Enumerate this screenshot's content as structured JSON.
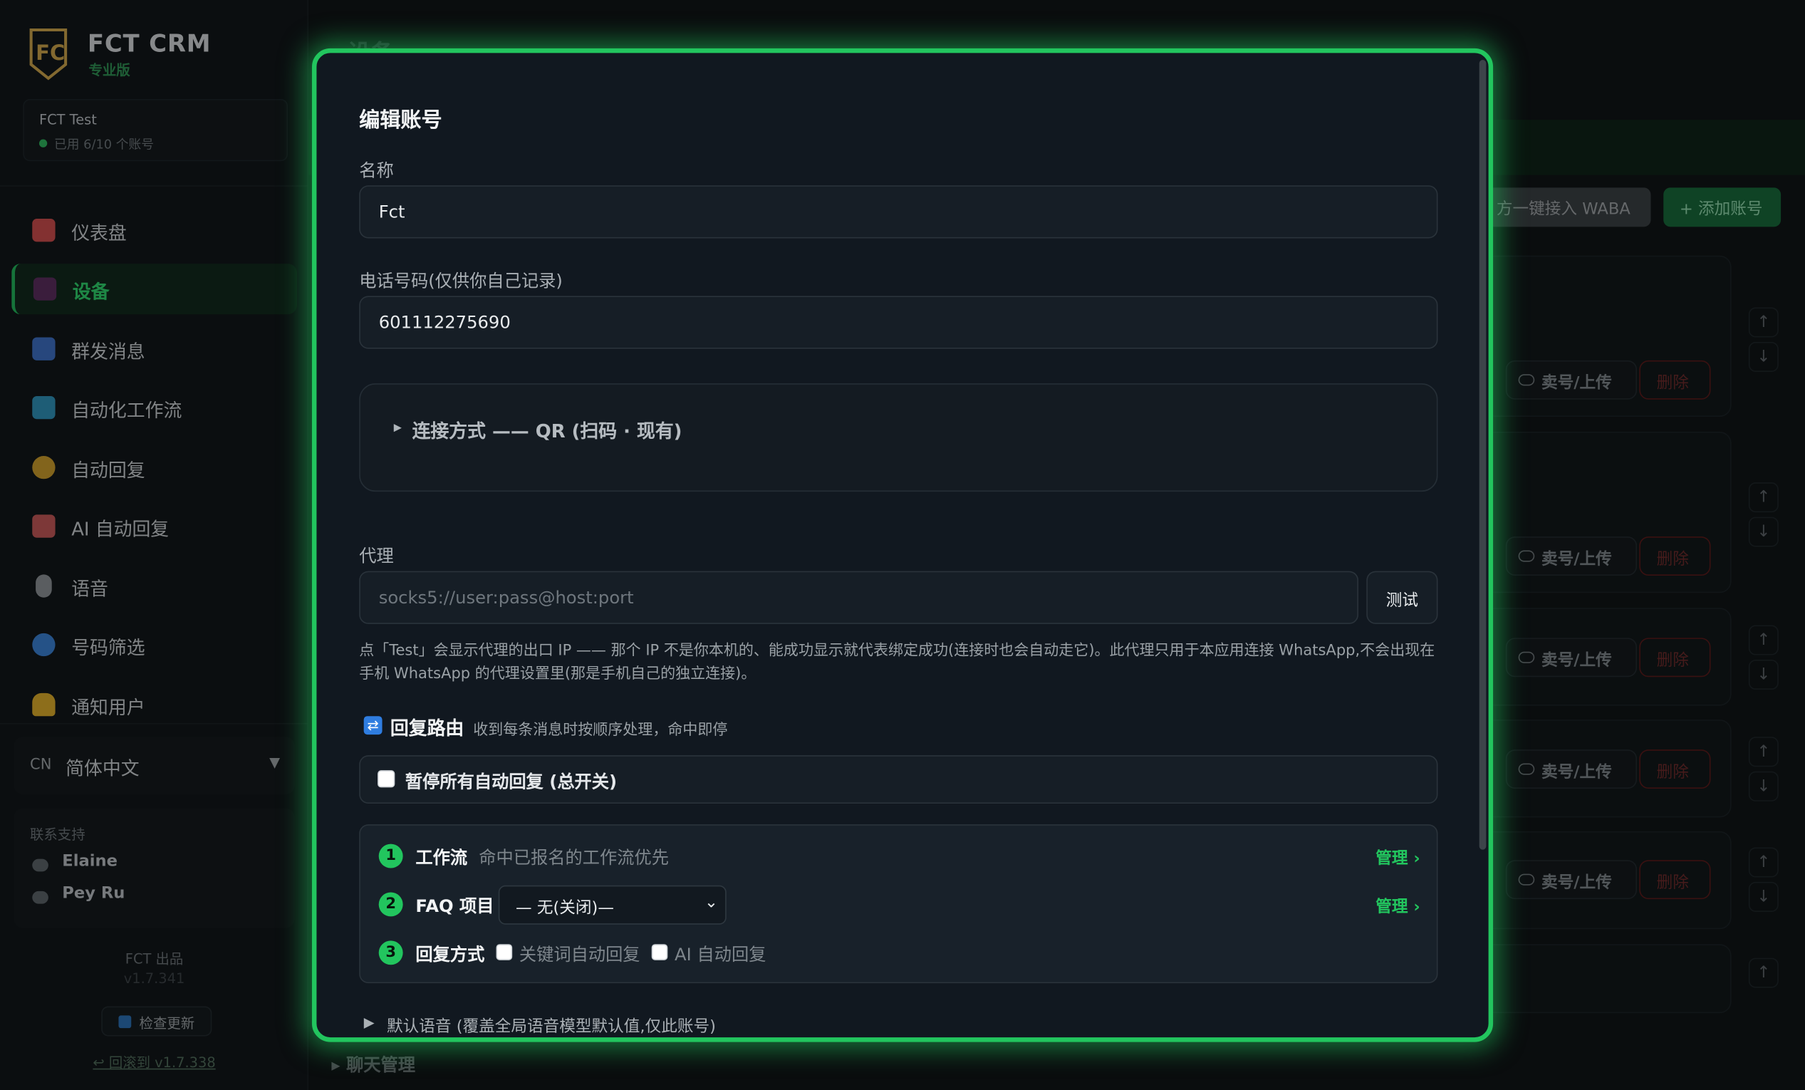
{
  "app": {
    "brand": "FCT CRM",
    "edition": "专业版"
  },
  "tenant": {
    "name": "FCT Test",
    "usage": "已用 6/10 个账号"
  },
  "nav": [
    {
      "label": "仪表盘",
      "icon": "chart-icon",
      "color": "#c94c4c"
    },
    {
      "label": "设备",
      "icon": "device-icon",
      "color": "#5a2d5c"
    },
    {
      "label": "群发消息",
      "icon": "broadcast-icon",
      "color": "#3c6ec0"
    },
    {
      "label": "自动化工作流",
      "icon": "workflow-icon",
      "color": "#2f8fb5"
    },
    {
      "label": "自动回复",
      "icon": "key-icon",
      "color": "#c89a2c"
    },
    {
      "label": "AI 自动回复",
      "icon": "robot-icon",
      "color": "#c05656"
    },
    {
      "label": "语音",
      "icon": "mic-icon",
      "color": "#8a8f94"
    },
    {
      "label": "号码筛选",
      "icon": "magnifier-icon",
      "color": "#3a7fd0"
    },
    {
      "label": "通知用户",
      "icon": "bell-icon",
      "color": "#d9a92a"
    }
  ],
  "language": {
    "code": "CN",
    "value": "简体中文"
  },
  "support": {
    "title": "联系支持",
    "people": [
      "Elaine",
      "Pey Ru"
    ]
  },
  "footer": {
    "made_by": "FCT 出品",
    "version": "v1.7.341",
    "check_update": "检查更新",
    "rollback": "↩ 回滚到 v1.7.338"
  },
  "main": {
    "page_title": "设备",
    "waba_button": "方一键接入 WABA",
    "add_button": "+ 添加账号",
    "sell_label": "卖号/上传",
    "delete_label": "删除",
    "chat_management": "聊天管理"
  },
  "modal": {
    "title": "编辑账号",
    "name_label": "名称",
    "name_value": "Fct",
    "phone_label": "电话号码(仅供你自己记录)",
    "phone_value": "601112275690",
    "connection_label": "连接方式 —— QR (扫码 · 现有)",
    "proxy_label": "代理",
    "proxy_placeholder": "socks5://user:pass@host:port",
    "test_button": "测试",
    "proxy_help": "点「Test」会显示代理的出口 IP —— 那个 IP 不是你本机的、能成功显示就代表绑定成功(连接时也会自动走它)。此代理只用于本应用连接 WhatsApp,不会出现在手机 WhatsApp 的代理设置里(那是手机自己的独立连接)。",
    "reply_routing_title": "回复路由",
    "reply_routing_desc": "收到每条消息时按顺序处理，命中即停",
    "pause_label": "暂停所有自动回复 (总开关)",
    "steps": [
      {
        "num": "1",
        "title": "工作流",
        "desc": "命中已报名的工作流优先",
        "manage": "管理 ›"
      },
      {
        "num": "2",
        "title": "FAQ 项目",
        "select": "— 无(关闭)—",
        "manage": "管理 ›"
      },
      {
        "num": "3",
        "title": "回复方式",
        "opt1": "关键词自动回复",
        "opt2": "AI 自动回复"
      }
    ],
    "default_language": "默认语音 (覆盖全局语音模型默认值,仅此账号)"
  }
}
